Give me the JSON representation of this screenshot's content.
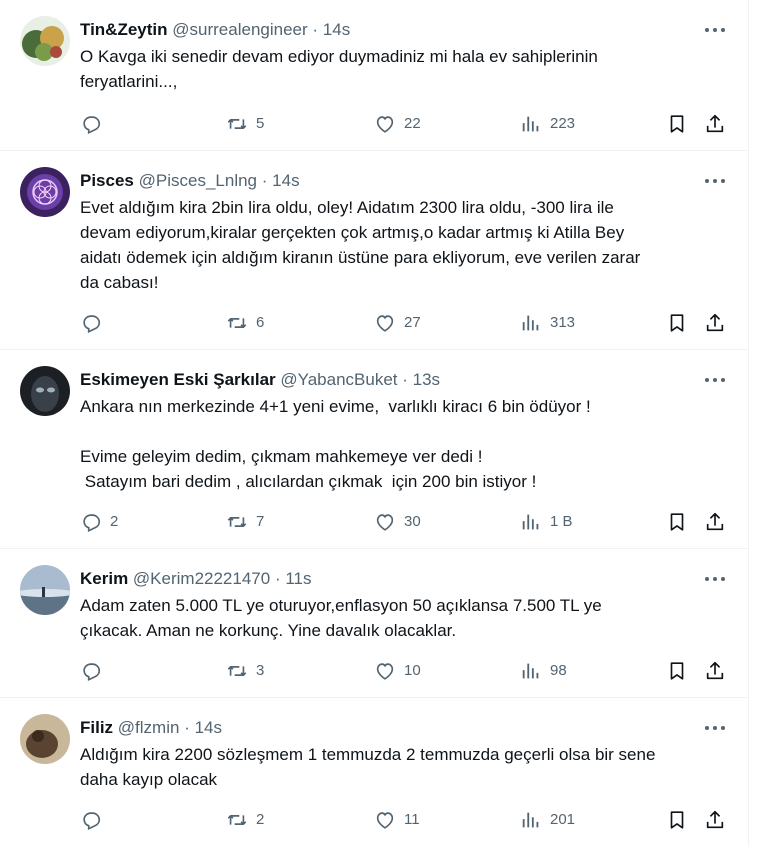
{
  "tweets": [
    {
      "name": "Tin&Zeytin",
      "handle": "@surrealengineer",
      "time": "14s",
      "text": "O Kavga iki senedir devam ediyor duymadiniz mi hala ev sahiplerinin\nferyatlarini...,",
      "replies": "",
      "retweets": "5",
      "likes": "22",
      "views": "223",
      "avatar_color": "#4a6b3a"
    },
    {
      "name": "Pisces",
      "handle": "@Pisces_Lnlng",
      "time": "14s",
      "text": "Evet aldığım kira 2bin lira oldu, oley! Aidatım 2300 lira oldu, -300 lira ile\ndevam ediyorum,kiralar gerçekten çok artmış,o kadar artmış ki Atilla Bey\naidatı ödemek için aldığım kiranın üstüne para ekliyorum, eve verilen zarar\nda cabası!",
      "replies": "",
      "retweets": "6",
      "likes": "27",
      "views": "313",
      "avatar_color": "#5a3b8c"
    },
    {
      "name": "Eskimeyen Eski Şarkılar",
      "handle": "@YabancBuket",
      "time": "13s",
      "text": "Ankara nın merkezinde 4+1 yeni evime,  varlıklı kiracı 6 bin ödüyor !\n\nEvime geleyim dedim, çıkmam mahkemeye ver dedi !\n Satayım bari dedim , alıcılardan çıkmak  için 200 bin istiyor !",
      "replies": "2",
      "retweets": "7",
      "likes": "30",
      "views": "1 B",
      "avatar_color": "#2b2f35"
    },
    {
      "name": "Kerim",
      "handle": "@Kerim22221470",
      "time": "11s",
      "text": "Adam zaten 5.000 TL ye oturuyor,enflasyon 50 açıklansa 7.500 TL ye\nçıkacak. Aman ne korkunç. Yine davalık olacaklar.",
      "replies": "",
      "retweets": "3",
      "likes": "10",
      "views": "98",
      "avatar_color": "#7f93a8"
    },
    {
      "name": "Filiz",
      "handle": "@flzmin",
      "time": "14s",
      "text": "Aldığım kira 2200 sözleşmem 1 temmuzda 2 temmuzda geçerli olsa bir sene\ndaha kayıp olacak",
      "replies": "",
      "retweets": "2",
      "likes": "11",
      "views": "201",
      "avatar_color": "#8a6a4a"
    }
  ],
  "separator": "·",
  "icons": [
    "reply-icon",
    "retweet-icon",
    "like-icon",
    "views-icon",
    "bookmark-icon",
    "share-icon",
    "more-icon"
  ]
}
